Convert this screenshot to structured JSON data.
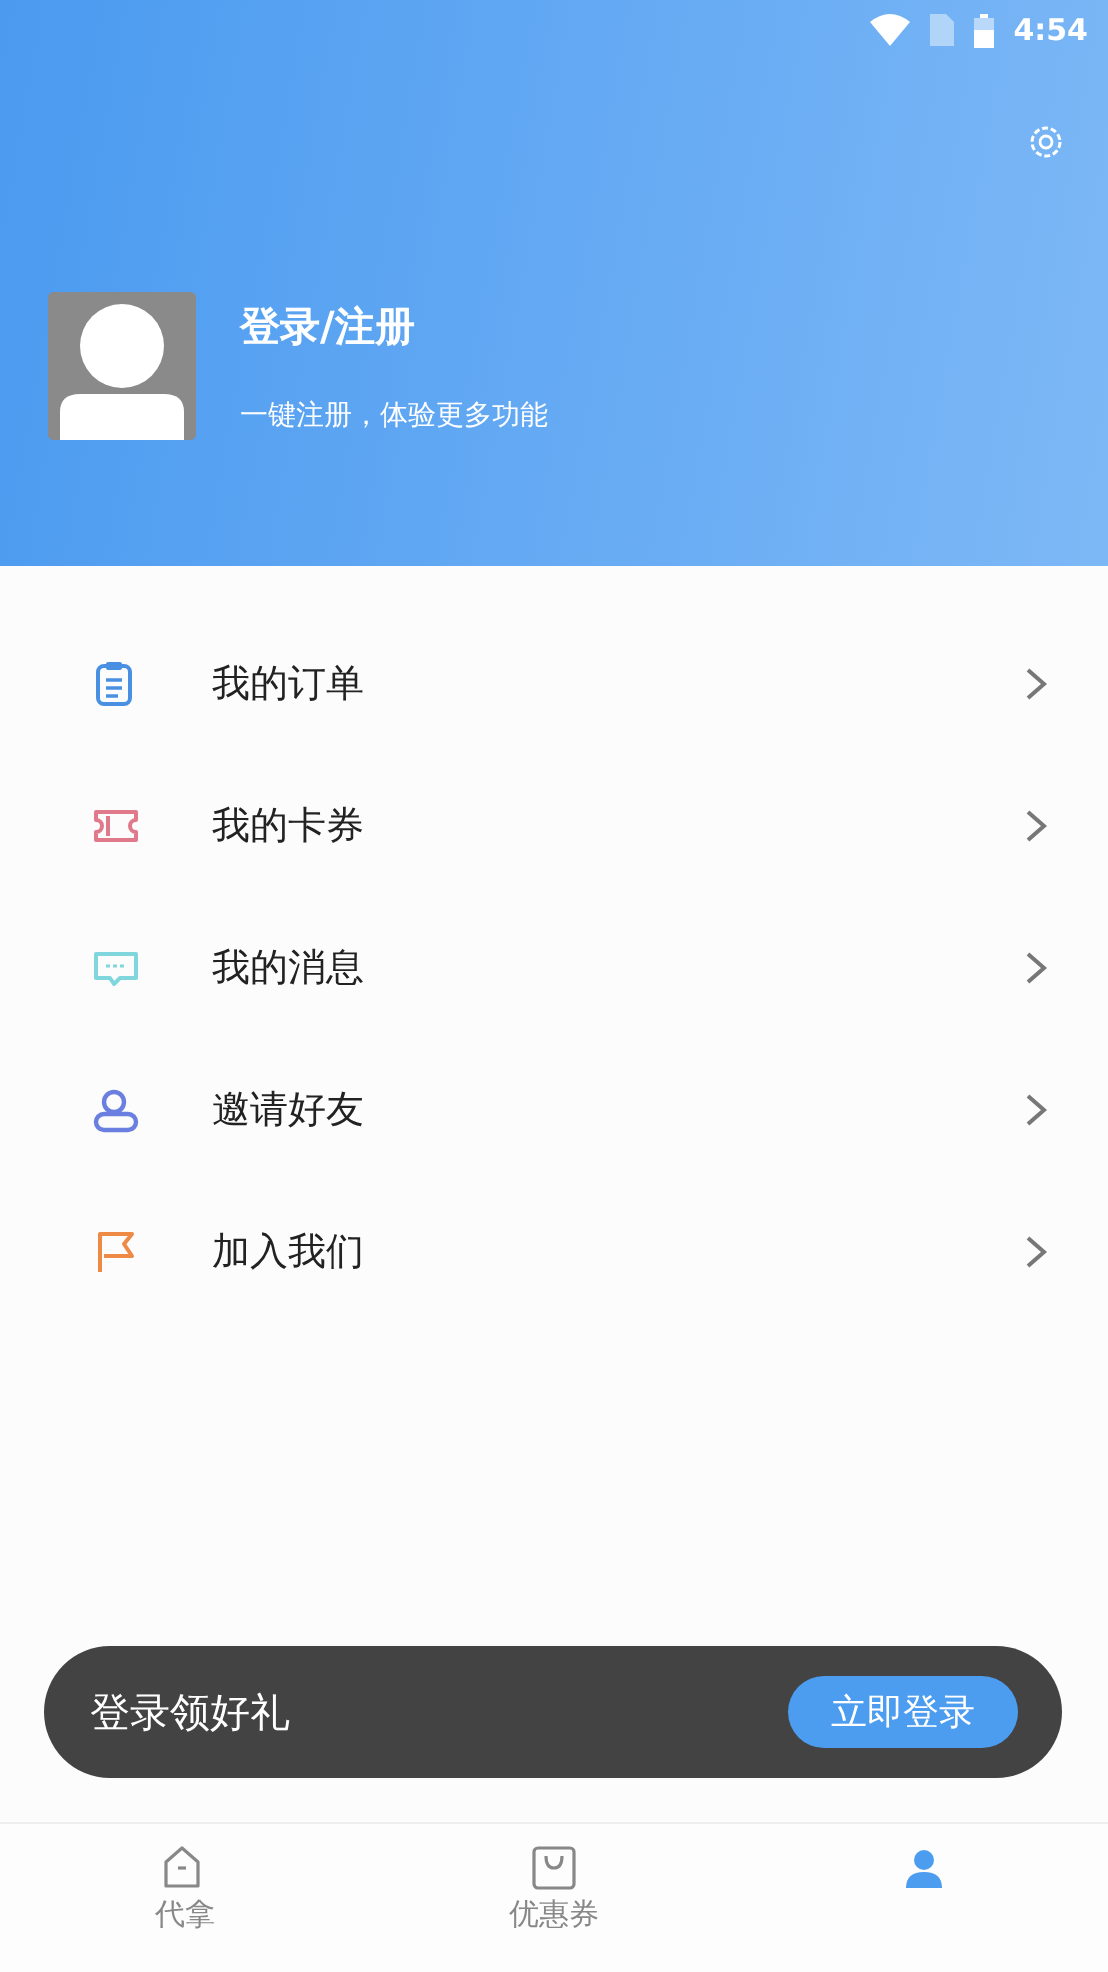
{
  "status_bar": {
    "time": "4:54"
  },
  "profile": {
    "title": "登录/注册",
    "subtitle": "一键注册，体验更多功能"
  },
  "menu": [
    {
      "kind": "orders",
      "label": "我的订单",
      "color": "#4a90e2"
    },
    {
      "kind": "coupons",
      "label": "我的卡券",
      "color": "#e07a8a"
    },
    {
      "kind": "messages",
      "label": "我的消息",
      "color": "#7fd6dc"
    },
    {
      "kind": "invite",
      "label": "邀请好友",
      "color": "#6a7fe0"
    },
    {
      "kind": "join",
      "label": "加入我们",
      "color": "#ee8a45"
    }
  ],
  "login_banner": {
    "text": "登录领好礼",
    "button": "立即登录"
  },
  "tabs": [
    {
      "kind": "home",
      "label": "代拿",
      "selected": false
    },
    {
      "kind": "bag",
      "label": "优惠券",
      "selected": false
    },
    {
      "kind": "user",
      "selected": true
    }
  ]
}
